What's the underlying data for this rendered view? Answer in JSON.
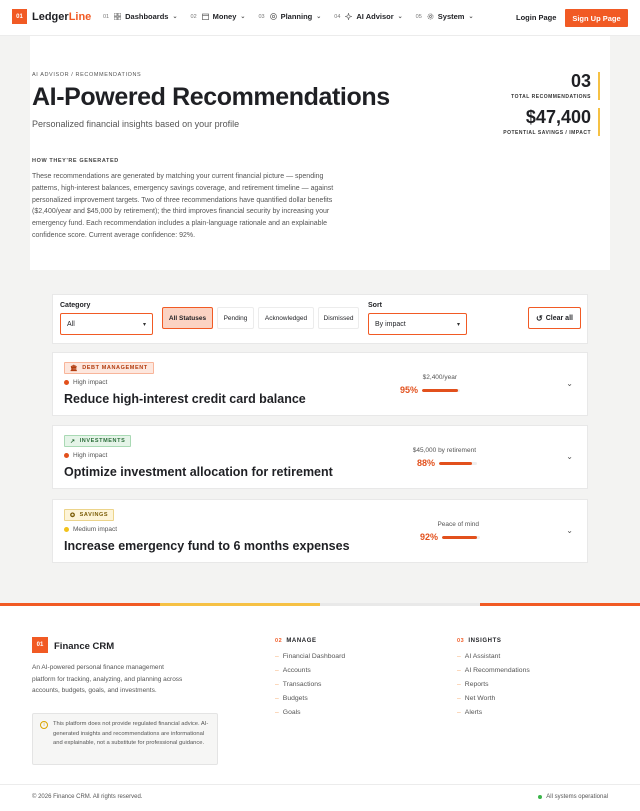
{
  "brand": {
    "badge": "01",
    "name_main": "Ledger",
    "name_accent": "Line",
    "accent": "#f15a24"
  },
  "nav": {
    "items": [
      {
        "num": "01",
        "label": "Dashboards",
        "icon": "grid-icon"
      },
      {
        "num": "02",
        "label": "Money",
        "icon": "wallet-icon"
      },
      {
        "num": "03",
        "label": "Planning",
        "icon": "target-icon"
      },
      {
        "num": "04",
        "label": "AI Advisor",
        "icon": "sparkle-icon"
      },
      {
        "num": "05",
        "label": "System",
        "icon": "gear-icon"
      }
    ],
    "login": "Login Page",
    "signup": "Sign Up Page"
  },
  "hero": {
    "breadcrumb": "AI ADVISOR / RECOMMENDATIONS",
    "title": "AI-Powered Recommendations",
    "subtitle": "Personalized financial insights based on your profile",
    "how_heading": "HOW THEY'RE GENERATED",
    "description": "These recommendations are generated by matching your current financial picture — spending patterns, high-interest balances, emergency savings coverage, and retirement timeline — against personalized improvement targets. Two of three recommendations have quantified dollar benefits ($2,400/year and $45,000 by retirement); the third improves financial security by increasing your emergency fund. Each recommendation includes a plain-language rationale and an explainable confidence score. Current average confidence: 92%.",
    "stats": [
      {
        "value": "03",
        "label": "TOTAL RECOMMENDATIONS"
      },
      {
        "value": "$47,400",
        "label": "POTENTIAL SAVINGS / IMPACT"
      }
    ]
  },
  "filters": {
    "category_label": "Category",
    "category_value": "All",
    "statuses": [
      "All Statuses",
      "Pending",
      "Acknowledged",
      "Dismissed"
    ],
    "active_status": "All Statuses",
    "sort_label": "Sort",
    "sort_value": "By impact",
    "clear_label": "Clear all"
  },
  "recommendations": [
    {
      "category": "DEBT MANAGEMENT",
      "icon": "bank-icon",
      "impact": "High impact",
      "impact_color": "#e2501c",
      "title": "Reduce high-interest credit card balance",
      "metric": "$2,400/year",
      "confidence": "95%",
      "confidence_value": 0.95
    },
    {
      "category": "INVESTMENTS",
      "icon": "trend-up-icon",
      "impact": "High impact",
      "impact_color": "#e2501c",
      "title": "Optimize investment allocation for retirement",
      "metric": "$45,000 by retirement",
      "confidence": "88%",
      "confidence_value": 0.88
    },
    {
      "category": "SAVINGS",
      "icon": "piggy-bank-icon",
      "impact": "Medium impact",
      "impact_color": "#f2c21b",
      "title": "Increase emergency fund to 6 months expenses",
      "metric": "Peace of mind",
      "confidence": "92%",
      "confidence_value": 0.92
    }
  ],
  "footer": {
    "badge": "01",
    "name": "Finance CRM",
    "description": "An AI-powered personal finance management platform for tracking, analyzing, and planning across accounts, budgets, goals, and investments.",
    "notice": "This platform does not provide regulated financial advice. AI-generated insights and recommendations are informational and explainable, not a substitute for professional guidance.",
    "manage": {
      "num": "02",
      "heading": "MANAGE",
      "links": [
        "Financial Dashboard",
        "Accounts",
        "Transactions",
        "Budgets",
        "Goals"
      ]
    },
    "insights": {
      "num": "03",
      "heading": "INSIGHTS",
      "links": [
        "AI Assistant",
        "AI Recommendations",
        "Reports",
        "Net Worth",
        "Alerts"
      ]
    },
    "copyright": "© 2026 Finance CRM. All rights reserved.",
    "status": "All systems operational"
  }
}
